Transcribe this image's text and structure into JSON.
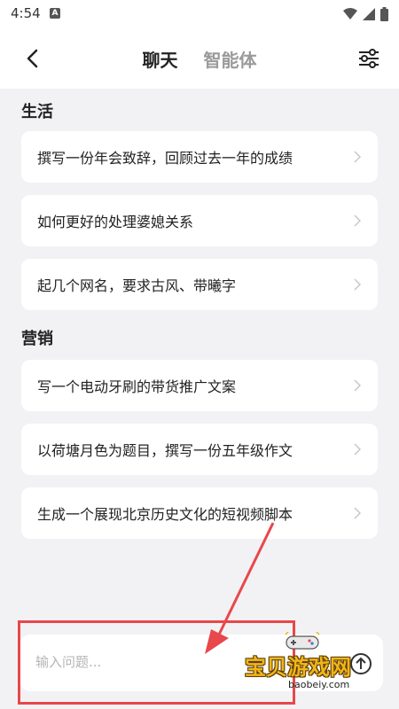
{
  "status_bar": {
    "time": "4:54",
    "notification_icon": "A"
  },
  "header": {
    "tabs": [
      {
        "label": "聊天",
        "active": true
      },
      {
        "label": "智能体",
        "active": false
      }
    ]
  },
  "sections": [
    {
      "title": "生活",
      "items": [
        "撰写一份年会致辞，回顾过去一年的成绩",
        "如何更好的处理婆媳关系",
        "起几个网名，要求古风、带曦字"
      ]
    },
    {
      "title": "营销",
      "items": [
        "写一个电动牙刷的带货推广文案",
        "以荷塘月色为题目，撰写一份五年级作文",
        "生成一个展现北京历史文化的短视频脚本"
      ]
    }
  ],
  "input": {
    "placeholder": "输入问题..."
  },
  "watermark": {
    "title": "宝贝游戏网",
    "url": "baobeiy.com"
  },
  "colors": {
    "annotation_red": "#e8474b",
    "background": "#f2f2f4"
  }
}
